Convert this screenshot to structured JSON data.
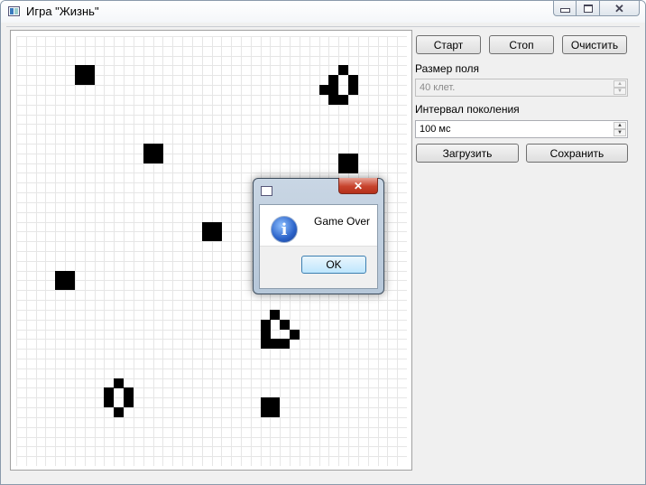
{
  "window": {
    "title": "Игра \"Жизнь\"",
    "app_icon": "app-window-icon",
    "caption_buttons": [
      "minimize",
      "maximize",
      "close"
    ]
  },
  "controls": {
    "start_label": "Старт",
    "stop_label": "Стоп",
    "clear_label": "Очистить",
    "field_size_label": "Размер поля",
    "field_size_value": "40 клет.",
    "field_size_enabled": false,
    "interval_label": "Интервал поколения",
    "interval_value": "100 мс",
    "load_label": "Загрузить",
    "save_label": "Сохранить"
  },
  "board": {
    "columns": 40,
    "rows": 44,
    "colors": {
      "grid": "#e6e6e6",
      "live": "#000000",
      "background": "#ffffff"
    },
    "live_cells": [
      [
        6,
        3
      ],
      [
        7,
        3
      ],
      [
        6,
        4
      ],
      [
        7,
        4
      ],
      [
        33,
        3
      ],
      [
        32,
        4
      ],
      [
        34,
        4
      ],
      [
        31,
        5
      ],
      [
        32,
        5
      ],
      [
        34,
        5
      ],
      [
        32,
        6
      ],
      [
        33,
        6
      ],
      [
        13,
        11
      ],
      [
        14,
        11
      ],
      [
        13,
        12
      ],
      [
        14,
        12
      ],
      [
        33,
        12
      ],
      [
        34,
        12
      ],
      [
        33,
        13
      ],
      [
        34,
        13
      ],
      [
        19,
        19
      ],
      [
        20,
        19
      ],
      [
        19,
        20
      ],
      [
        20,
        20
      ],
      [
        4,
        24
      ],
      [
        5,
        24
      ],
      [
        4,
        25
      ],
      [
        5,
        25
      ],
      [
        26,
        28
      ],
      [
        25,
        29
      ],
      [
        27,
        29
      ],
      [
        25,
        30
      ],
      [
        28,
        30
      ],
      [
        25,
        31
      ],
      [
        26,
        31
      ],
      [
        27,
        31
      ],
      [
        10,
        35
      ],
      [
        9,
        36
      ],
      [
        11,
        36
      ],
      [
        9,
        37
      ],
      [
        11,
        37
      ],
      [
        10,
        38
      ],
      [
        25,
        37
      ],
      [
        26,
        37
      ],
      [
        25,
        38
      ],
      [
        26,
        38
      ]
    ]
  },
  "dialog": {
    "message": "Game Over",
    "ok_label": "OK",
    "icon": "info-icon"
  }
}
